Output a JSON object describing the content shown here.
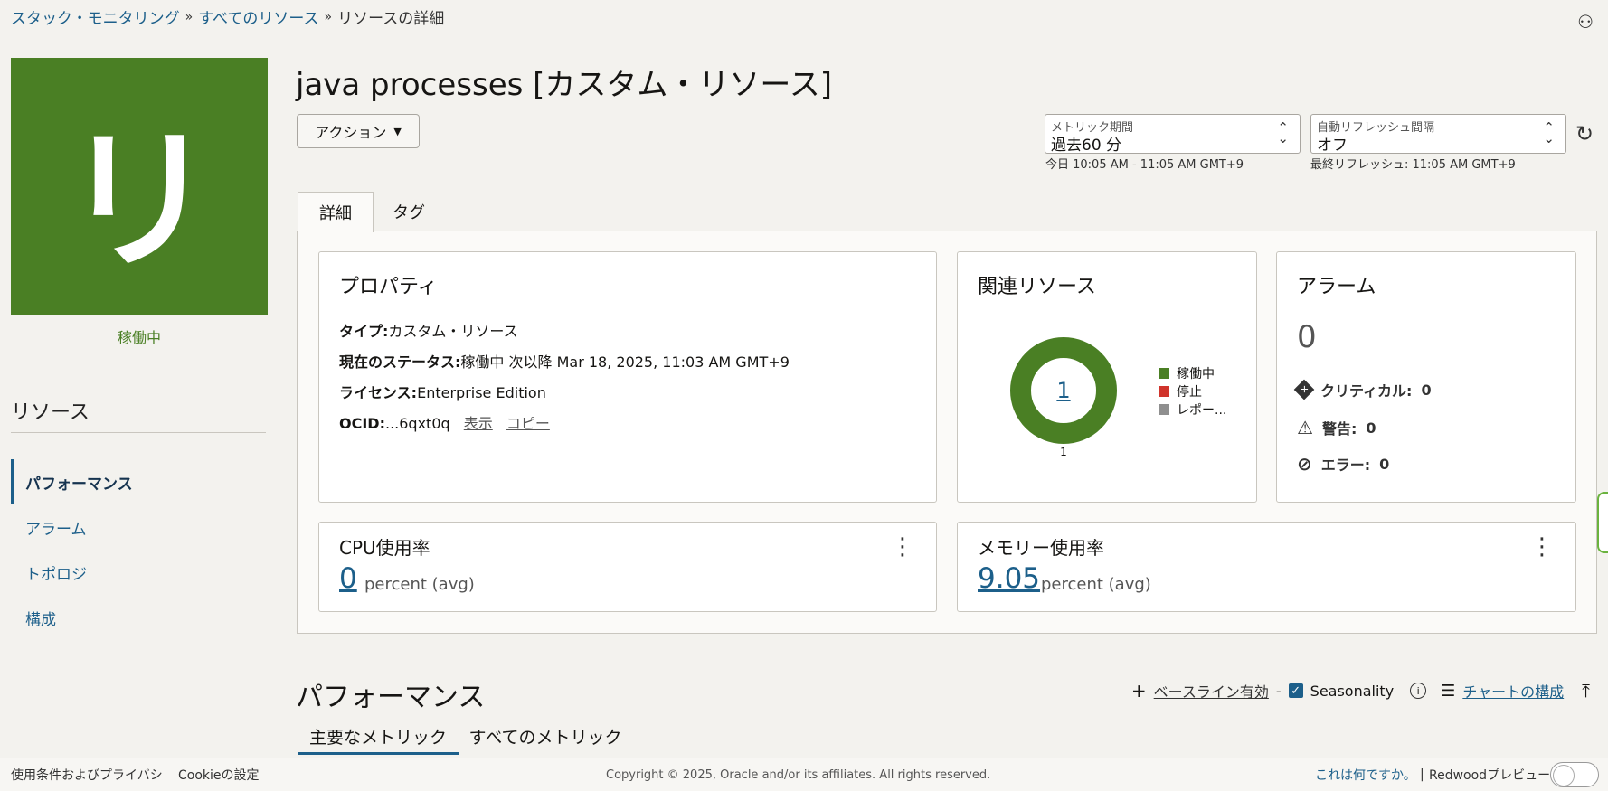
{
  "breadcrumb": {
    "items": [
      "スタック・モニタリング",
      "すべてのリソース"
    ],
    "separator": "»",
    "current": "リソースの詳細"
  },
  "avatar": {
    "letter": "リ",
    "status": "稼働中"
  },
  "sidebar": {
    "title": "リソース",
    "items": [
      {
        "label": "パフォーマンス",
        "active": true
      },
      {
        "label": "アラーム"
      },
      {
        "label": "トポロジ"
      },
      {
        "label": "構成"
      }
    ]
  },
  "header": {
    "title": "java processes [カスタム・リソース]",
    "action_label": "アクション",
    "metric_period": {
      "label": "メトリック期間",
      "value": "過去60 分",
      "note": "今日 10:05 AM - 11:05 AM GMT+9"
    },
    "auto_refresh": {
      "label": "自動リフレッシュ間隔",
      "value": "オフ",
      "note": "最終リフレッシュ: 11:05 AM GMT+9"
    }
  },
  "tabs": {
    "details": "詳細",
    "tags": "タグ"
  },
  "properties": {
    "title": "プロパティ",
    "type_label": "タイプ:",
    "type_value": "カスタム・リソース",
    "status_label": "現在のステータス:",
    "status_value": "稼働中 次以降 Mar 18, 2025, 11:03 AM GMT+9",
    "license_label": "ライセンス:",
    "license_value": "Enterprise Edition",
    "ocid_label": "OCID:",
    "ocid_value": "...6qxt0q",
    "show_link": "表示",
    "copy_link": "コピー"
  },
  "related": {
    "title": "関連リソース",
    "center_value": "1",
    "bottom_label": "1",
    "legend": [
      {
        "label": "稼働中",
        "color": "#4a7f24"
      },
      {
        "label": "停止",
        "color": "#d0342c"
      },
      {
        "label": "レポー...",
        "color": "#8f8f8f"
      }
    ]
  },
  "alarms": {
    "title": "アラーム",
    "total": "0",
    "critical": "クリティカル:",
    "critical_count": "0",
    "warning": "警告:",
    "warning_count": "0",
    "error": "エラー:",
    "error_count": "0"
  },
  "cpu": {
    "title": "CPU使用率",
    "value": "0",
    "unit": "percent (avg)"
  },
  "memory": {
    "title": "メモリー使用率",
    "value": "9.05",
    "unit": "percent (avg)"
  },
  "performance": {
    "title": "パフォーマンス",
    "baseline": "ベースライン有効",
    "dash": "-",
    "seasonality": "Seasonality",
    "configure_chart": "チャートの構成",
    "subtabs": [
      "主要なメトリック",
      "すべてのメトリック"
    ]
  },
  "footer": {
    "terms": "使用条件およびプライバシ",
    "cookies": "Cookieの設定",
    "copyright": "Copyright © 2025, Oracle and/or its affiliates. All rights reserved.",
    "whats_this": "これは何ですか。",
    "divider": "|",
    "redwood": "Redwoodプレビュー"
  },
  "colors": {
    "accent": "#1c5f8a",
    "status_green": "#4a7f24"
  }
}
